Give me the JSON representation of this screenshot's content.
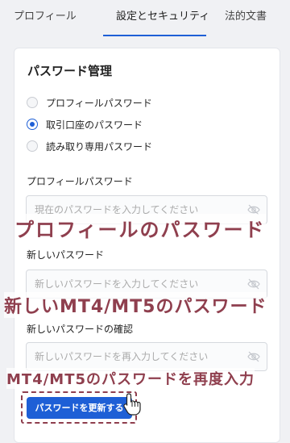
{
  "tabs": [
    {
      "label": "プロフィール"
    },
    {
      "label": "設定とセキュリティ"
    },
    {
      "label": "法的文書"
    }
  ],
  "active_tab": "設定とセキュリティ",
  "password_section": {
    "title": "パスワード管理",
    "options": [
      {
        "label": "プロフィールパスワード",
        "checked": false
      },
      {
        "label": "取引口座のパスワード",
        "checked": true
      },
      {
        "label": "読み取り専用パスワード",
        "checked": false
      }
    ]
  },
  "fields": [
    {
      "label": "プロフィールパスワード",
      "placeholder": "現在のパスワードを入力してください",
      "icon": "eye-off-icon"
    },
    {
      "label": "新しいパスワード",
      "placeholder": "新しいパスワードを入力してください",
      "icon": "eye-off-icon"
    },
    {
      "label": "新しいパスワードの確認",
      "placeholder": "新しいパスワードを再入力してください",
      "icon": "eye-off-icon"
    }
  ],
  "annotations": [
    "プロフィールのパスワード",
    "新しいMT4/MT5のパスワード",
    "MT4/MT5のパスワードを再度入力"
  ],
  "submit_button": {
    "label": "パスワードを更新する"
  },
  "colors": {
    "accent": "#1e5fd6",
    "annotation": "#8f3f4e"
  }
}
